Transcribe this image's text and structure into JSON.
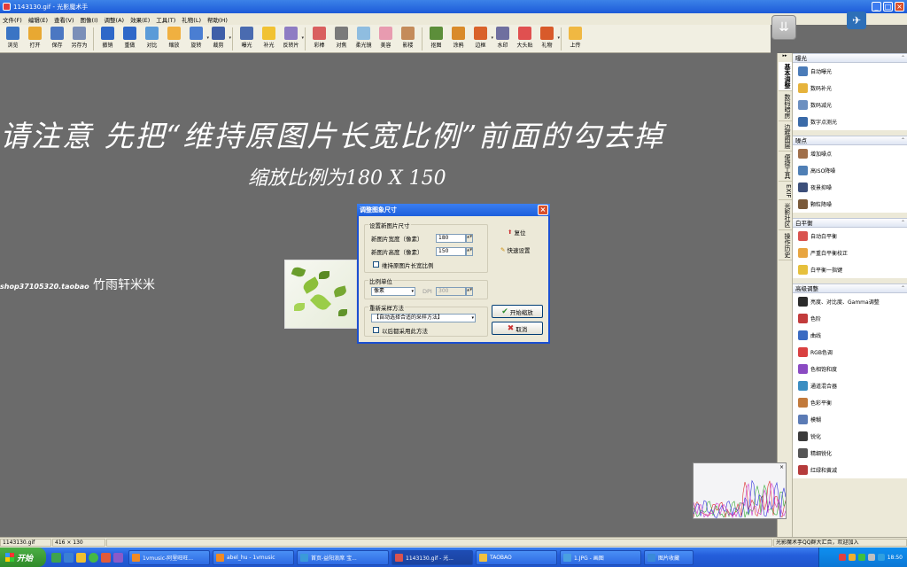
{
  "window": {
    "title": "1143130.gif - 光影魔术手"
  },
  "menus": [
    "文件(F)",
    "编辑(E)",
    "查看(V)",
    "图像(I)",
    "调整(A)",
    "效果(E)",
    "工具(T)",
    "礼物(L)",
    "帮助(H)"
  ],
  "toolbar": [
    {
      "label": "浏览",
      "icon": "browse-icon",
      "color": "#3a74c4"
    },
    {
      "label": "打开",
      "icon": "open-folder-icon",
      "color": "#e8a832"
    },
    {
      "label": "保存",
      "icon": "save-icon",
      "color": "#4b77c2"
    },
    {
      "label": "另存为",
      "icon": "save-as-icon",
      "color": "#7b8fb8"
    },
    {
      "sep": true
    },
    {
      "label": "撤销",
      "icon": "undo-icon",
      "color": "#2f68c8"
    },
    {
      "label": "重做",
      "icon": "redo-icon",
      "color": "#2f68c8"
    },
    {
      "label": "对比",
      "icon": "compare-icon",
      "color": "#5b9bd8"
    },
    {
      "label": "缩放",
      "icon": "resize-icon",
      "color": "#f0b040"
    },
    {
      "label": "旋转",
      "icon": "rotate-icon",
      "color": "#4a7ed2",
      "dd": true
    },
    {
      "label": "裁剪",
      "icon": "crop-icon",
      "color": "#3f5fa8",
      "dd": true
    },
    {
      "sep": true
    },
    {
      "label": "曝光",
      "icon": "exposure-icon",
      "color": "#4a6bb0"
    },
    {
      "label": "补光",
      "icon": "fill-light-icon",
      "color": "#f1c232"
    },
    {
      "label": "反转片",
      "icon": "reversal-film-icon",
      "color": "#8e7cc3",
      "dd": true
    },
    {
      "sep": true
    },
    {
      "label": "彩棒",
      "icon": "color-wand-icon",
      "color": "#d95f5f"
    },
    {
      "label": "对焦",
      "icon": "focus-icon",
      "color": "#7a7a7a"
    },
    {
      "label": "柔光镜",
      "icon": "soft-lens-icon",
      "color": "#8fbde0"
    },
    {
      "label": "美容",
      "icon": "beauty-icon",
      "color": "#e89bb0"
    },
    {
      "label": "影楼",
      "icon": "studio-icon",
      "color": "#c48b5a"
    },
    {
      "sep": true
    },
    {
      "label": "抠图",
      "icon": "cutout-icon",
      "color": "#5c8e3a"
    },
    {
      "label": "涂鸦",
      "icon": "graffiti-icon",
      "color": "#d98a2a"
    },
    {
      "label": "边框",
      "icon": "frame-icon",
      "color": "#d9622a",
      "dd": true
    },
    {
      "label": "水印",
      "icon": "watermark-icon",
      "color": "#6f6f9f"
    },
    {
      "label": "大头贴",
      "icon": "sticker-icon",
      "color": "#e05050"
    },
    {
      "label": "礼物",
      "icon": "gift-icon",
      "color": "#d85a2a",
      "dd": true
    },
    {
      "sep": true
    },
    {
      "label": "上传",
      "icon": "upload-icon",
      "color": "#f0b842"
    }
  ],
  "canvas": {
    "overlay_line1": "请注意 先把“维持原图片长宽比例”前面的勾去掉",
    "overlay_line2": "缩放比例为180 X 150",
    "shop_id": "shop37105320.taobao",
    "shop_name": "竹雨轩米米"
  },
  "dialog": {
    "title": "调整图象尺寸",
    "group_size": "设置新图片尺寸",
    "width_label": "新图片宽度（像素）",
    "width_value": "180",
    "height_label": "新图片高度（像素）",
    "height_value": "150",
    "keep_ratio": "维持原图片长宽比例",
    "reset": "复位",
    "quick_set": "快速设置",
    "group_unit": "比例单位",
    "unit_value": "像素",
    "dpi_label": "DPI",
    "dpi_value": "300",
    "group_resample": "重新采样方法",
    "resample_value": "【自动选择合适的采样方法】",
    "always_use": "以后都采用此方法",
    "start": "开始缩放",
    "cancel": "取消"
  },
  "right_panel": {
    "tabs": [
      {
        "label": "基本调整",
        "active": true
      },
      {
        "label": "数码暗房"
      },
      {
        "label": "边框图层"
      },
      {
        "label": "便捷工具"
      },
      {
        "label": "EXIF"
      },
      {
        "label": "光影社区"
      },
      {
        "label": "操作历史"
      }
    ],
    "sections": [
      {
        "title": "曝光",
        "items": [
          {
            "label": "自动曝光",
            "icon": "auto-exposure-icon",
            "color": "#4a7bb8"
          },
          {
            "label": "数码补光",
            "icon": "digital-fill-light-icon",
            "color": "#e6b33c"
          },
          {
            "label": "数码减光",
            "icon": "digital-reduce-light-icon",
            "color": "#6b8fc0"
          },
          {
            "label": "数字点测光",
            "icon": "spot-metering-icon",
            "color": "#3a6aa8"
          }
        ]
      },
      {
        "title": "噪点",
        "items": [
          {
            "label": "增加噪点",
            "icon": "add-noise-icon",
            "color": "#a06f4a"
          },
          {
            "label": "高ISO降噪",
            "icon": "high-iso-denoise-icon",
            "color": "#4f7fb5"
          },
          {
            "label": "夜景抑噪",
            "icon": "night-denoise-icon",
            "color": "#3c4f7a"
          },
          {
            "label": "颗粒降噪",
            "icon": "grain-denoise-icon",
            "color": "#7a5a3a"
          }
        ]
      },
      {
        "title": "白平衡",
        "items": [
          {
            "label": "自动白平衡",
            "icon": "auto-wb-icon",
            "color": "#d9534f"
          },
          {
            "label": "严重白平衡校正",
            "icon": "wb-correction-icon",
            "color": "#e8a540"
          },
          {
            "label": "白平衡一指键",
            "icon": "wb-one-touch-icon",
            "color": "#e6c03c"
          }
        ]
      },
      {
        "title": "高级调整",
        "items": [
          {
            "label": "亮度、对比度、Gamma调整",
            "icon": "brightness-icon",
            "color": "#2b2b2b"
          },
          {
            "label": "色阶",
            "icon": "levels-icon",
            "color": "#c23b3b"
          },
          {
            "label": "曲线",
            "icon": "curves-icon",
            "color": "#3b6bc2"
          },
          {
            "label": "RGB色调",
            "icon": "rgb-tone-icon",
            "color": "#d94040"
          },
          {
            "label": "色相饱和度",
            "icon": "hue-saturation-icon",
            "color": "#8a4ac2"
          },
          {
            "label": "通道混合器",
            "icon": "channel-mixer-icon",
            "color": "#3b8ec2"
          },
          {
            "label": "色彩平衡",
            "icon": "color-balance-icon",
            "color": "#c27a3b"
          },
          {
            "label": "模糊",
            "icon": "blur-icon",
            "color": "#5b7bb5"
          },
          {
            "label": "锐化",
            "icon": "sharpen-icon",
            "color": "#3b3b3b"
          },
          {
            "label": "精细锐化",
            "icon": "fine-sharpen-icon",
            "color": "#555"
          },
          {
            "label": "红绿和黄减",
            "icon": "red-green-icon",
            "color": "#b53b3b"
          }
        ]
      }
    ]
  },
  "status": {
    "filename": "1143130.gif",
    "size": "416 × 130",
    "tip": "光影魔术手QQ群大汇合，欢迎加入"
  },
  "taskbar": {
    "start": "开始",
    "tasks": [
      {
        "label": "1vmusic-阿里旺旺...",
        "color": "#f08a24",
        "w": 92
      },
      {
        "label": "abel_hu - 1vmusic",
        "color": "#f08a24",
        "w": 92
      },
      {
        "label": "首页-益阳浪席 宝...",
        "color": "#3a9ad9",
        "w": 104
      },
      {
        "label": "1143130.gif - 光...",
        "color": "#d9534f",
        "w": 92,
        "active": true
      },
      {
        "label": "TAOBAO",
        "color": "#f0c040",
        "w": 92
      },
      {
        "label": "1.JPG - 画图",
        "color": "#4aa0e0",
        "w": 92
      },
      {
        "label": "图片收藏",
        "color": "#3a8ad9",
        "w": 56
      }
    ],
    "clock": "18:50"
  },
  "colors": {
    "titlebar": "#2060dc",
    "canvas_bg": "#6b6b6b",
    "panel_bg": "#ece9d8"
  }
}
